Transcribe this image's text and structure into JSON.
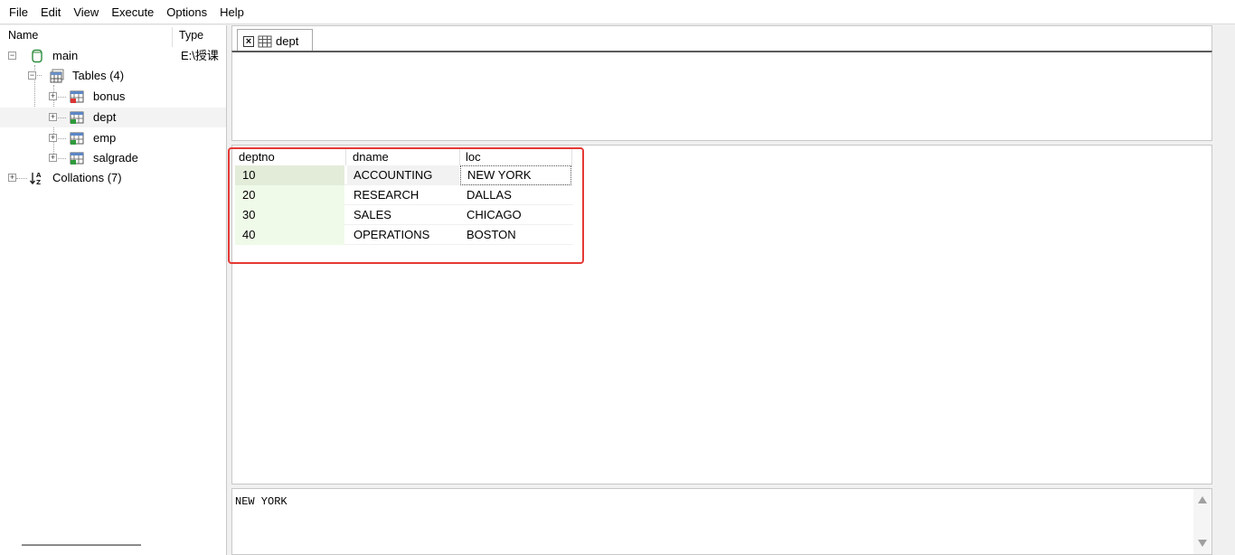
{
  "menu": [
    "File",
    "Edit",
    "View",
    "Execute",
    "Options",
    "Help"
  ],
  "tree": {
    "header": {
      "name": "Name",
      "type": "Type"
    },
    "root": {
      "label": "main",
      "type": "E:\\授课"
    },
    "tables_node": {
      "label": "Tables (4)"
    },
    "tables": [
      "bonus",
      "dept",
      "emp",
      "salgrade"
    ],
    "collations": {
      "label": "Collations (7)"
    }
  },
  "tab": {
    "label": "dept"
  },
  "grid": {
    "columns": [
      "deptno",
      "dname",
      "loc"
    ],
    "rows": [
      [
        "10",
        "ACCOUNTING",
        "NEW YORK"
      ],
      [
        "20",
        "RESEARCH",
        "DALLAS"
      ],
      [
        "30",
        "SALES",
        "CHICAGO"
      ],
      [
        "40",
        "OPERATIONS",
        "BOSTON"
      ]
    ]
  },
  "cell_text": "NEW YORK",
  "colors": {
    "highlight": "#e53935",
    "key_column": "#f0fae8"
  }
}
